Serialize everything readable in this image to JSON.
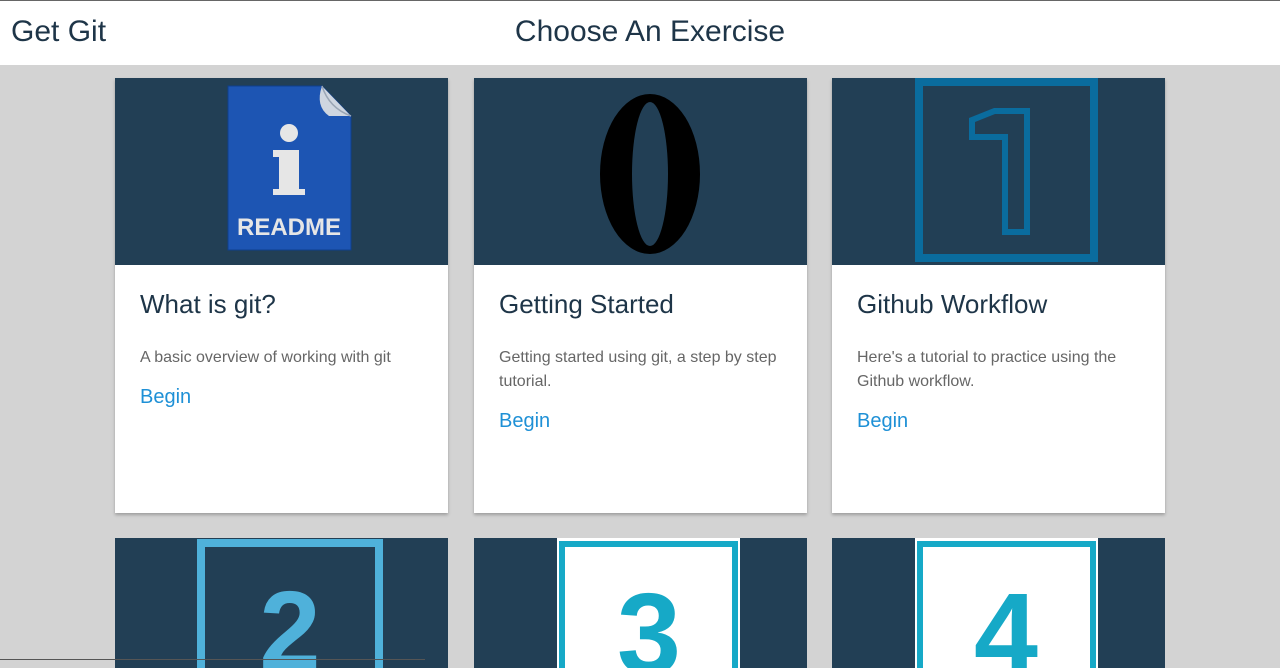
{
  "header": {
    "brand": "Get Git",
    "title": "Choose An Exercise"
  },
  "colors": {
    "banner_bg": "#223f55",
    "link": "#1e90d6",
    "title_text": "#1e3548",
    "page_bg": "#d3d3d3"
  },
  "cards": [
    {
      "icon": "readme-document-icon",
      "icon_text": "README",
      "icon_letter": "i",
      "title": "What is git?",
      "description": "A basic overview of working with git",
      "link": "Begin"
    },
    {
      "icon": "number-zero-icon",
      "icon_text": "0",
      "title": "Getting Started",
      "description": "Getting started using git, a step by step tutorial.",
      "link": "Begin"
    },
    {
      "icon": "number-one-icon",
      "icon_text": "1",
      "title": "Github Workflow",
      "description": "Here's a tutorial to practice using the Github workflow.",
      "link": "Begin"
    }
  ],
  "partial_cards": [
    {
      "icon": "number-two-icon",
      "icon_text": "2"
    },
    {
      "icon": "number-three-icon",
      "icon_text": "3"
    },
    {
      "icon": "number-four-icon",
      "icon_text": "4"
    }
  ]
}
